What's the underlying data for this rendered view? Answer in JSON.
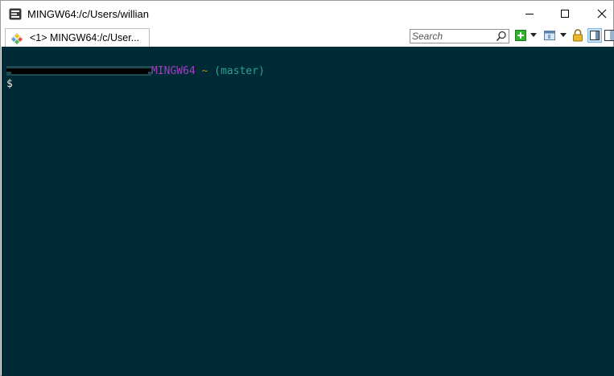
{
  "window": {
    "title": "MINGW64:/c/Users/willian"
  },
  "tabs": [
    {
      "label": "<1> MINGW64:/c/User..."
    }
  ],
  "search": {
    "placeholder": "Search",
    "value": ""
  },
  "toolbar": {
    "icons": [
      "search-icon",
      "new-console-icon",
      "dropdown-arrow-icon",
      "console-view-icon",
      "dropdown-arrow-icon",
      "lock-icon",
      "panel-view-icon",
      "panel-view-icon"
    ]
  },
  "terminal": {
    "prompt_host": "MINGW64",
    "prompt_path": "~",
    "prompt_branch": "(master)",
    "prompt_symbol": "$"
  },
  "colors": {
    "terminal_bg": "#002b36",
    "host_color": "#a03fbf",
    "path_color": "#b58900",
    "branch_color": "#2aa198"
  }
}
